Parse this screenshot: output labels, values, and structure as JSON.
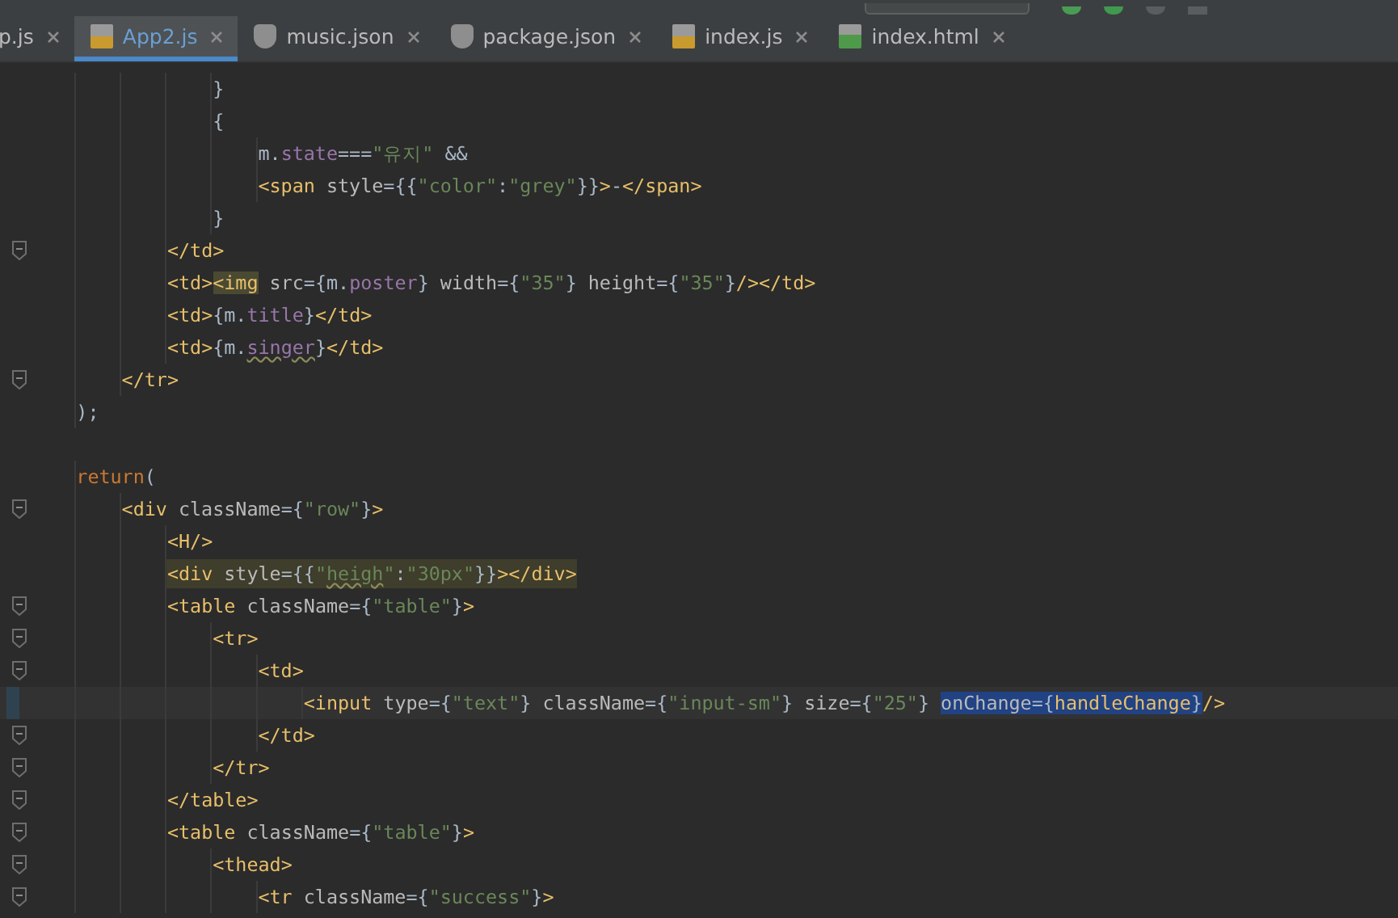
{
  "tabs": [
    {
      "label": "p.js",
      "selected": false
    },
    {
      "label": "App2.js",
      "kind": "js",
      "selected": true
    },
    {
      "label": "music.json",
      "kind": "json",
      "selected": false
    },
    {
      "label": "package.json",
      "kind": "json",
      "selected": false
    },
    {
      "label": "index.js",
      "kind": "js",
      "selected": false
    },
    {
      "label": "index.html",
      "kind": "html",
      "selected": false
    }
  ],
  "code_lines": [
    {
      "fold": false,
      "tokens": [
        {
          "kind": "plain",
          "text": "                }"
        }
      ]
    },
    {
      "fold": false,
      "tokens": [
        {
          "kind": "plain",
          "text": "                {"
        }
      ]
    },
    {
      "fold": false,
      "tokens": [
        {
          "kind": "plain",
          "text": "                    m."
        },
        {
          "kind": "prop",
          "text": "state"
        },
        {
          "kind": "plain",
          "text": "==="
        },
        {
          "kind": "str",
          "text": "\"유지\""
        },
        {
          "kind": "plain",
          "text": " &&"
        }
      ]
    },
    {
      "fold": false,
      "tokens": [
        {
          "kind": "tag",
          "text": "                    <span "
        },
        {
          "kind": "attr",
          "text": "style"
        },
        {
          "kind": "plain",
          "text": "={{"
        },
        {
          "kind": "str",
          "text": "\"color\""
        },
        {
          "kind": "plain",
          "text": ":"
        },
        {
          "kind": "str",
          "text": "\"grey\""
        },
        {
          "kind": "plain",
          "text": "}}"
        },
        {
          "kind": "tag",
          "text": ">"
        },
        {
          "kind": "plain",
          "text": "-"
        },
        {
          "kind": "tag",
          "text": "</span>"
        }
      ]
    },
    {
      "fold": false,
      "tokens": [
        {
          "kind": "plain",
          "text": "                }"
        }
      ]
    },
    {
      "fold": true,
      "tokens": [
        {
          "kind": "tag",
          "text": "            </td>"
        }
      ]
    },
    {
      "fold": false,
      "tokens": [
        {
          "kind": "tag",
          "text": "            <td>"
        },
        {
          "kind": "tag",
          "text": "<img",
          "matched": true
        },
        {
          "kind": "attr",
          "text": " src"
        },
        {
          "kind": "plain",
          "text": "={m."
        },
        {
          "kind": "prop",
          "text": "poster"
        },
        {
          "kind": "plain",
          "text": "} "
        },
        {
          "kind": "attr",
          "text": "width"
        },
        {
          "kind": "plain",
          "text": "={"
        },
        {
          "kind": "str",
          "text": "\"35\""
        },
        {
          "kind": "plain",
          "text": "} "
        },
        {
          "kind": "attr",
          "text": "height"
        },
        {
          "kind": "plain",
          "text": "={"
        },
        {
          "kind": "str",
          "text": "\"35\""
        },
        {
          "kind": "plain",
          "text": "}"
        },
        {
          "kind": "tag",
          "text": "/></td>"
        }
      ]
    },
    {
      "fold": false,
      "tokens": [
        {
          "kind": "tag",
          "text": "            <td>"
        },
        {
          "kind": "plain",
          "text": "{m."
        },
        {
          "kind": "prop",
          "text": "title"
        },
        {
          "kind": "plain",
          "text": "}"
        },
        {
          "kind": "tag",
          "text": "</td>"
        }
      ]
    },
    {
      "fold": false,
      "tokens": [
        {
          "kind": "tag",
          "text": "            <td>"
        },
        {
          "kind": "plain",
          "text": "{m."
        },
        {
          "kind": "prop",
          "text": "singer",
          "typo": true
        },
        {
          "kind": "plain",
          "text": "}"
        },
        {
          "kind": "tag",
          "text": "</td>"
        }
      ]
    },
    {
      "fold": true,
      "tokens": [
        {
          "kind": "tag",
          "text": "        </tr>"
        }
      ]
    },
    {
      "fold": false,
      "tokens": [
        {
          "kind": "plain",
          "text": "    );"
        }
      ]
    },
    {
      "fold": false
    },
    {
      "fold": false,
      "tokens": [
        {
          "kind": "kw",
          "text": "    return"
        },
        {
          "kind": "plain",
          "text": "("
        }
      ]
    },
    {
      "fold": true,
      "tokens": [
        {
          "kind": "tag",
          "text": "        <div "
        },
        {
          "kind": "attr",
          "text": "className"
        },
        {
          "kind": "plain",
          "text": "={"
        },
        {
          "kind": "str",
          "text": "\"row\""
        },
        {
          "kind": "plain",
          "text": "}"
        },
        {
          "kind": "tag",
          "text": ">"
        }
      ]
    },
    {
      "fold": false,
      "tokens": [
        {
          "kind": "tag",
          "text": "            <H/>"
        }
      ]
    },
    {
      "fold": false,
      "highlighted": true,
      "tokens": [
        {
          "kind": "tag",
          "text": "            <div "
        },
        {
          "kind": "attr",
          "text": "style"
        },
        {
          "kind": "plain",
          "text": "={{"
        },
        {
          "kind": "str",
          "text": "\""
        },
        {
          "kind": "str",
          "text": "heigh",
          "typo": true
        },
        {
          "kind": "str",
          "text": "\""
        },
        {
          "kind": "plain",
          "text": ":"
        },
        {
          "kind": "str",
          "text": "\"30px\""
        },
        {
          "kind": "plain",
          "text": "}}"
        },
        {
          "kind": "tag",
          "text": "></div>"
        }
      ]
    },
    {
      "fold": true,
      "tokens": [
        {
          "kind": "tag",
          "text": "            <table "
        },
        {
          "kind": "attr",
          "text": "className"
        },
        {
          "kind": "plain",
          "text": "={"
        },
        {
          "kind": "str",
          "text": "\"table\""
        },
        {
          "kind": "plain",
          "text": "}"
        },
        {
          "kind": "tag",
          "text": ">"
        }
      ]
    },
    {
      "fold": true,
      "tokens": [
        {
          "kind": "tag",
          "text": "                <tr>"
        }
      ]
    },
    {
      "fold": true,
      "tokens": [
        {
          "kind": "tag",
          "text": "                    <td>"
        }
      ]
    },
    {
      "fold": false,
      "current": true,
      "tokens": [
        {
          "kind": "tag",
          "text": "                        <input "
        },
        {
          "kind": "attr",
          "text": "type"
        },
        {
          "kind": "plain",
          "text": "={"
        },
        {
          "kind": "str",
          "text": "\"text\""
        },
        {
          "kind": "plain",
          "text": "} "
        },
        {
          "kind": "attr",
          "text": "className"
        },
        {
          "kind": "plain",
          "text": "={"
        },
        {
          "kind": "str",
          "text": "\"input-sm\""
        },
        {
          "kind": "plain",
          "text": "} "
        },
        {
          "kind": "attr",
          "text": "size"
        },
        {
          "kind": "plain",
          "text": "={"
        },
        {
          "kind": "str",
          "text": "\"25\""
        },
        {
          "kind": "plain",
          "text": "} "
        },
        {
          "kind": "attr",
          "text": "onChange",
          "selected": true
        },
        {
          "kind": "plain",
          "text": "={",
          "selected": true
        },
        {
          "kind": "tag",
          "text": "handleChange",
          "selected": true
        },
        {
          "kind": "plain",
          "text": "}",
          "selected": true
        },
        {
          "kind": "tag",
          "text": "/>"
        }
      ]
    },
    {
      "fold": true,
      "tokens": [
        {
          "kind": "tag",
          "text": "                    </td>"
        }
      ]
    },
    {
      "fold": true,
      "tokens": [
        {
          "kind": "tag",
          "text": "                </tr>"
        }
      ]
    },
    {
      "fold": true,
      "tokens": [
        {
          "kind": "tag",
          "text": "            </table>"
        }
      ]
    },
    {
      "fold": true,
      "tokens": [
        {
          "kind": "tag",
          "text": "            <table "
        },
        {
          "kind": "attr",
          "text": "className"
        },
        {
          "kind": "plain",
          "text": "={"
        },
        {
          "kind": "str",
          "text": "\"table\""
        },
        {
          "kind": "plain",
          "text": "}"
        },
        {
          "kind": "tag",
          "text": ">"
        }
      ]
    },
    {
      "fold": true,
      "tokens": [
        {
          "kind": "tag",
          "text": "                <thead>"
        }
      ]
    },
    {
      "fold": true,
      "tokens": [
        {
          "kind": "tag",
          "text": "                    <tr "
        },
        {
          "kind": "attr",
          "text": "className"
        },
        {
          "kind": "plain",
          "text": "={"
        },
        {
          "kind": "str",
          "text": "\"success\""
        },
        {
          "kind": "plain",
          "text": "}"
        },
        {
          "kind": "tag",
          "text": ">"
        }
      ]
    }
  ]
}
